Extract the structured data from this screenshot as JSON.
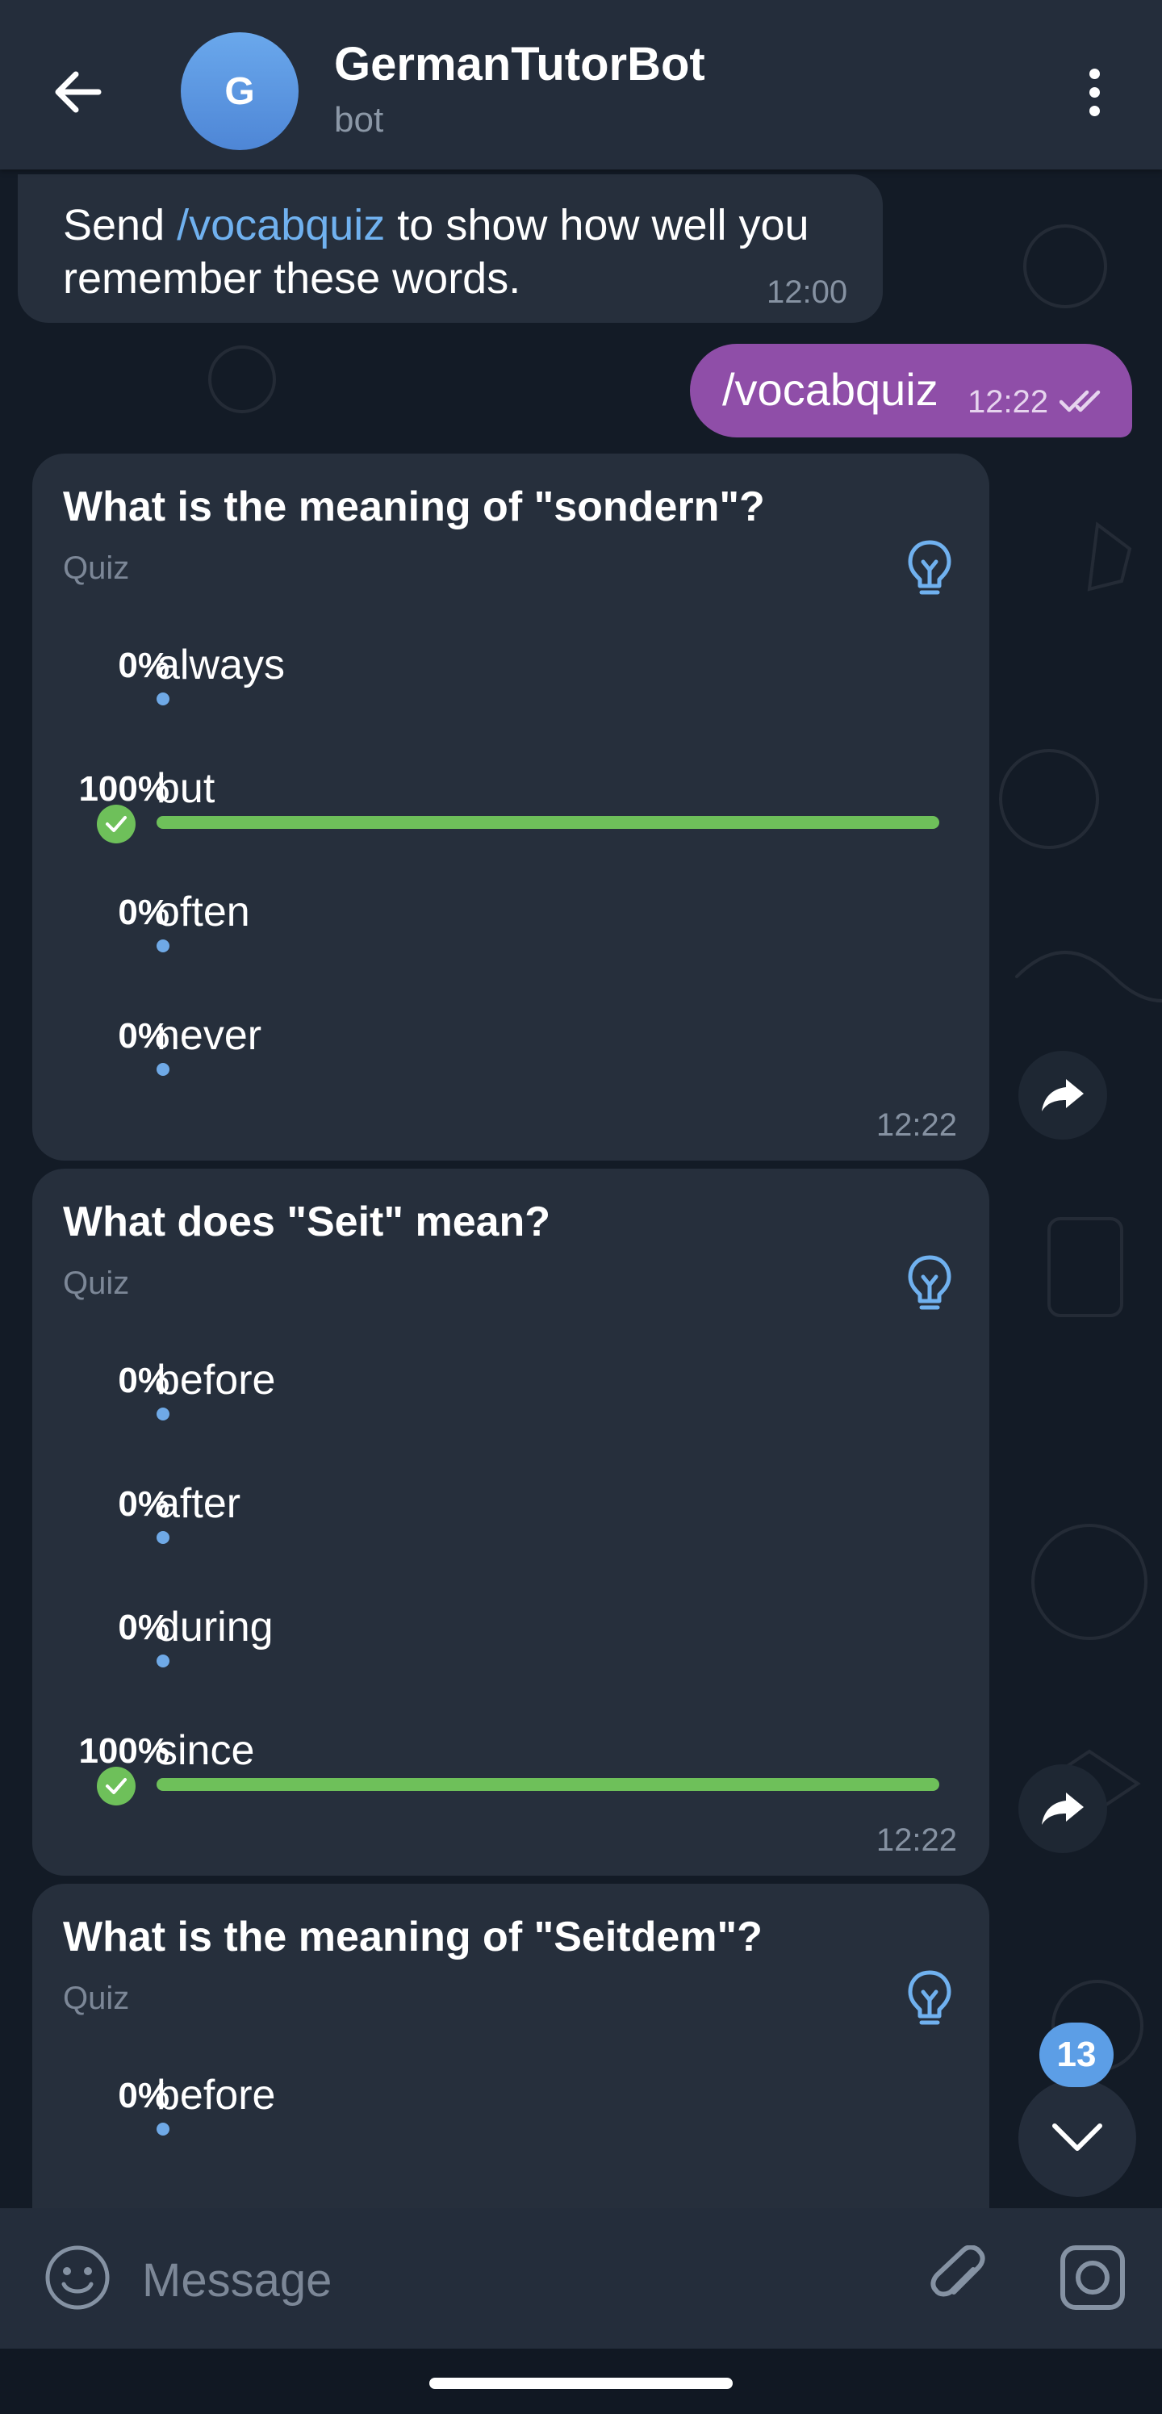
{
  "header": {
    "title": "GermanTutorBot",
    "subtitle": "bot",
    "avatar_letter": "G",
    "back_icon": "arrow-left-icon",
    "menu_icon": "more-vertical-icon"
  },
  "messages": {
    "intro": {
      "text_before": "Send ",
      "command": "/vocabquiz",
      "text_after": " to show how well you remember these words.",
      "time": "12:00"
    },
    "outgoing": {
      "text": "/vocabquiz",
      "time": "12:22",
      "status_icon": "double-check-icon"
    }
  },
  "quizzes": [
    {
      "question": "What is the meaning of \"sondern\"?",
      "type_label": "Quiz",
      "time": "12:22",
      "options": [
        {
          "percent": "0%",
          "label": "always",
          "share": 0,
          "correct": false
        },
        {
          "percent": "100%",
          "label": "but",
          "share": 1,
          "correct": true
        },
        {
          "percent": "0%",
          "label": "often",
          "share": 0,
          "correct": false
        },
        {
          "percent": "0%",
          "label": "never",
          "share": 0,
          "correct": false
        }
      ]
    },
    {
      "question": "What does \"Seit\" mean?",
      "type_label": "Quiz",
      "time": "12:22",
      "options": [
        {
          "percent": "0%",
          "label": "before",
          "share": 0,
          "correct": false
        },
        {
          "percent": "0%",
          "label": "after",
          "share": 0,
          "correct": false
        },
        {
          "percent": "0%",
          "label": "during",
          "share": 0,
          "correct": false
        },
        {
          "percent": "100%",
          "label": "since",
          "share": 1,
          "correct": true
        }
      ]
    },
    {
      "question": "What is the meaning of \"Seitdem\"?",
      "type_label": "Quiz",
      "options": [
        {
          "percent": "0%",
          "label": "before",
          "share": 0,
          "correct": false
        }
      ]
    }
  ],
  "scroll_down": {
    "unread_count": "13"
  },
  "input": {
    "placeholder": "Message"
  },
  "colors": {
    "accent_link": "#70b1ef",
    "outgoing_bubble": "#8f4ea8",
    "correct_green": "#6ec05a",
    "badge_blue": "#5c9ee6"
  }
}
